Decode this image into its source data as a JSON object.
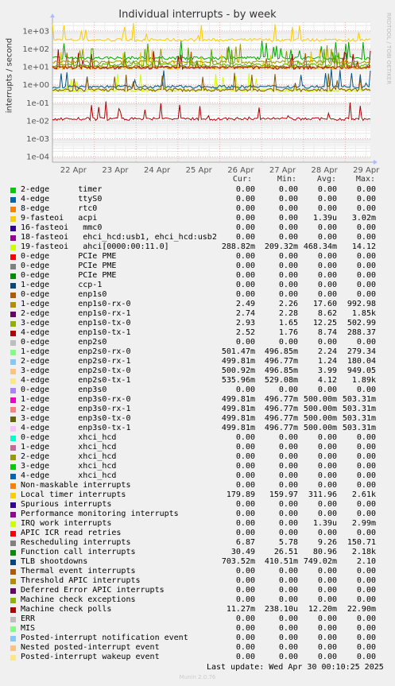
{
  "title": "Individual interrupts - by week",
  "side_text": "RRDTOOL / TOBI OETIKER",
  "footer": "Munin 2.0.76",
  "last_update": "Last update: Wed Apr 30 00:10:25 2025",
  "columns": [
    "Cur:",
    "Min:",
    "Avg:",
    "Max:"
  ],
  "chart_data": {
    "type": "line",
    "title": "Individual interrupts - by week",
    "ylabel": "interrupts / second",
    "yscale": "log",
    "ylim": [
      5e-05,
      3000
    ],
    "yticks": [
      "1e+03",
      "1e+02",
      "1e+01",
      "1e+00",
      "1e-01",
      "1e-02",
      "1e-03",
      "1e-04"
    ],
    "ytick_values": [
      1000,
      100,
      10,
      1,
      0.1,
      0.01,
      0.001,
      0.0001
    ],
    "xlim": [
      0,
      7.6
    ],
    "xticks": [
      "22 Apr",
      "23 Apr",
      "24 Apr",
      "25 Apr",
      "26 Apr",
      "27 Apr",
      "28 Apr",
      "29 Apr"
    ],
    "xtick_values": [
      0.5,
      1.5,
      2.5,
      3.5,
      4.5,
      5.5,
      6.5,
      7.5
    ],
    "grid": true,
    "series": [
      {
        "name": "Local timer interrupts",
        "color": "#ffcc00",
        "base": 300,
        "avg": 311.96
      },
      {
        "name": "Function call interrupts",
        "color": "#00aa00",
        "base": 30,
        "avg": 80.96
      },
      {
        "name": "2-edge enp1s0-rx-1",
        "color": "#f0c400",
        "base": 8.6,
        "avg": 8.62
      },
      {
        "name": "4-edge enp1s0-tx-1",
        "color": "#aa0000",
        "base": 8.7,
        "avg": 8.74
      },
      {
        "name": "Rescheduling interrupts",
        "color": "#aa5500",
        "base": 9.3,
        "avg": 9.26
      },
      {
        "name": "1-edge enp1s0-rx-0",
        "color": "#999900",
        "base": 17.6,
        "avg": 17.6
      },
      {
        "name": "3-edge enp1s0-tx-0",
        "color": "#55aa00",
        "base": 12.2,
        "avg": 12.25
      },
      {
        "name": "19-fasteoi ahci[0000:00:11.0]",
        "color": "#ccff00",
        "base": 0.47,
        "avg": 0.46834
      },
      {
        "name": "TLB shootdowns",
        "color": "#00558a",
        "base": 0.75,
        "avg": 0.74902
      },
      {
        "name": "3-edge enp3s0-tx-0",
        "color": "#8a5500",
        "base": 0.5,
        "avg": 0.5
      },
      {
        "name": "Machine check polls",
        "color": "#aa0000",
        "base": 0.0122,
        "avg": 0.0122
      }
    ]
  },
  "legend": [
    {
      "color": "#00cc00",
      "name": "2-edge      timer",
      "cur": "0.00",
      "min": "0.00",
      "avg": "0.00",
      "max": "0.00"
    },
    {
      "color": "#0066b3",
      "name": "4-edge      ttyS0",
      "cur": "0.00",
      "min": "0.00",
      "avg": "0.00",
      "max": "0.00"
    },
    {
      "color": "#ff8000",
      "name": "8-edge      rtc0",
      "cur": "0.00",
      "min": "0.00",
      "avg": "0.00",
      "max": "0.00"
    },
    {
      "color": "#ffcc00",
      "name": "9-fasteoi   acpi",
      "cur": "0.00",
      "min": "0.00",
      "avg": "1.39u",
      "max": "3.02m"
    },
    {
      "color": "#330099",
      "name": "16-fasteoi   mmc0",
      "cur": "0.00",
      "min": "0.00",
      "avg": "0.00",
      "max": "0.00"
    },
    {
      "color": "#990099",
      "name": "18-fasteoi   ehci_hcd:usb1, ehci_hcd:usb2",
      "cur": "0.00",
      "min": "0.00",
      "avg": "0.00",
      "max": "0.00"
    },
    {
      "color": "#ccff00",
      "name": "19-fasteoi   ahci[0000:00:11.0]",
      "cur": "288.82m",
      "min": "209.32m",
      "avg": "468.34m",
      "max": "14.12"
    },
    {
      "color": "#ff0000",
      "name": "0-edge      PCIe PME",
      "cur": "0.00",
      "min": "0.00",
      "avg": "0.00",
      "max": "0.00"
    },
    {
      "color": "#808080",
      "name": "0-edge      PCIe PME",
      "cur": "0.00",
      "min": "0.00",
      "avg": "0.00",
      "max": "0.00"
    },
    {
      "color": "#008f00",
      "name": "0-edge      PCIe PME",
      "cur": "0.00",
      "min": "0.00",
      "avg": "0.00",
      "max": "0.00"
    },
    {
      "color": "#00487d",
      "name": "1-edge      ccp-1",
      "cur": "0.00",
      "min": "0.00",
      "avg": "0.00",
      "max": "0.00"
    },
    {
      "color": "#b35a00",
      "name": "0-edge      enp1s0",
      "cur": "0.00",
      "min": "0.00",
      "avg": "0.00",
      "max": "0.00"
    },
    {
      "color": "#b38f00",
      "name": "1-edge      enp1s0-rx-0",
      "cur": "2.49",
      "min": "2.26",
      "avg": "17.60",
      "max": "992.98"
    },
    {
      "color": "#6b006b",
      "name": "2-edge      enp1s0-rx-1",
      "cur": "2.74",
      "min": "2.28",
      "avg": "8.62",
      "max": "1.85k"
    },
    {
      "color": "#8fb300",
      "name": "3-edge      enp1s0-tx-0",
      "cur": "2.93",
      "min": "1.65",
      "avg": "12.25",
      "max": "502.99"
    },
    {
      "color": "#b30000",
      "name": "4-edge      enp1s0-tx-1",
      "cur": "2.52",
      "min": "1.76",
      "avg": "8.74",
      "max": "288.37"
    },
    {
      "color": "#bebebe",
      "name": "0-edge      enp2s0",
      "cur": "0.00",
      "min": "0.00",
      "avg": "0.00",
      "max": "0.00"
    },
    {
      "color": "#80ff80",
      "name": "1-edge      enp2s0-rx-0",
      "cur": "501.47m",
      "min": "496.85m",
      "avg": "2.24",
      "max": "279.34"
    },
    {
      "color": "#80c9ff",
      "name": "2-edge      enp2s0-rx-1",
      "cur": "499.81m",
      "min": "496.77m",
      "avg": "1.24",
      "max": "180.04"
    },
    {
      "color": "#ffc080",
      "name": "3-edge      enp2s0-tx-0",
      "cur": "500.92m",
      "min": "496.85m",
      "avg": "3.99",
      "max": "949.05"
    },
    {
      "color": "#ffe680",
      "name": "4-edge      enp2s0-tx-1",
      "cur": "535.96m",
      "min": "529.08m",
      "avg": "4.12",
      "max": "1.89k"
    },
    {
      "color": "#aa80ff",
      "name": "0-edge      enp3s0",
      "cur": "0.00",
      "min": "0.00",
      "avg": "0.00",
      "max": "0.00"
    },
    {
      "color": "#ee00cc",
      "name": "1-edge      enp3s0-rx-0",
      "cur": "499.81m",
      "min": "496.77m",
      "avg": "500.00m",
      "max": "503.31m"
    },
    {
      "color": "#ff8080",
      "name": "2-edge      enp3s0-rx-1",
      "cur": "499.81m",
      "min": "496.77m",
      "avg": "500.00m",
      "max": "503.31m"
    },
    {
      "color": "#666600",
      "name": "3-edge      enp3s0-tx-0",
      "cur": "499.81m",
      "min": "496.77m",
      "avg": "500.00m",
      "max": "503.31m"
    },
    {
      "color": "#ffbfff",
      "name": "4-edge      enp3s0-tx-1",
      "cur": "499.81m",
      "min": "496.77m",
      "avg": "500.00m",
      "max": "503.31m"
    },
    {
      "color": "#00ffcc",
      "name": "0-edge      xhci_hcd",
      "cur": "0.00",
      "min": "0.00",
      "avg": "0.00",
      "max": "0.00"
    },
    {
      "color": "#cc6699",
      "name": "1-edge      xhci_hcd",
      "cur": "0.00",
      "min": "0.00",
      "avg": "0.00",
      "max": "0.00"
    },
    {
      "color": "#999900",
      "name": "2-edge      xhci_hcd",
      "cur": "0.00",
      "min": "0.00",
      "avg": "0.00",
      "max": "0.00"
    },
    {
      "color": "#00cc00",
      "name": "3-edge      xhci_hcd",
      "cur": "0.00",
      "min": "0.00",
      "avg": "0.00",
      "max": "0.00"
    },
    {
      "color": "#0066b3",
      "name": "4-edge      xhci_hcd",
      "cur": "0.00",
      "min": "0.00",
      "avg": "0.00",
      "max": "0.00"
    },
    {
      "color": "#ff8000",
      "name": "Non-maskable interrupts",
      "cur": "0.00",
      "min": "0.00",
      "avg": "0.00",
      "max": "0.00"
    },
    {
      "color": "#ffcc00",
      "name": "Local timer interrupts",
      "cur": "179.89",
      "min": "159.97",
      "avg": "311.96",
      "max": "2.61k"
    },
    {
      "color": "#330099",
      "name": "Spurious interrupts",
      "cur": "0.00",
      "min": "0.00",
      "avg": "0.00",
      "max": "0.00"
    },
    {
      "color": "#990099",
      "name": "Performance monitoring interrupts",
      "cur": "0.00",
      "min": "0.00",
      "avg": "0.00",
      "max": "0.00"
    },
    {
      "color": "#ccff00",
      "name": "IRQ work interrupts",
      "cur": "0.00",
      "min": "0.00",
      "avg": "1.39u",
      "max": "2.99m"
    },
    {
      "color": "#ff0000",
      "name": "APIC ICR read retries",
      "cur": "0.00",
      "min": "0.00",
      "avg": "0.00",
      "max": "0.00"
    },
    {
      "color": "#808080",
      "name": "Rescheduling interrupts",
      "cur": "6.87",
      "min": "5.78",
      "avg": "9.26",
      "max": "150.71"
    },
    {
      "color": "#008f00",
      "name": "Function call interrupts",
      "cur": "30.49",
      "min": "26.51",
      "avg": "80.96",
      "max": "2.18k"
    },
    {
      "color": "#00487d",
      "name": "TLB shootdowns",
      "cur": "703.52m",
      "min": "410.51m",
      "avg": "749.02m",
      "max": "2.10"
    },
    {
      "color": "#b35a00",
      "name": "Thermal event interrupts",
      "cur": "0.00",
      "min": "0.00",
      "avg": "0.00",
      "max": "0.00"
    },
    {
      "color": "#b38f00",
      "name": "Threshold APIC interrupts",
      "cur": "0.00",
      "min": "0.00",
      "avg": "0.00",
      "max": "0.00"
    },
    {
      "color": "#6b006b",
      "name": "Deferred Error APIC interrupts",
      "cur": "0.00",
      "min": "0.00",
      "avg": "0.00",
      "max": "0.00"
    },
    {
      "color": "#8fb300",
      "name": "Machine check exceptions",
      "cur": "0.00",
      "min": "0.00",
      "avg": "0.00",
      "max": "0.00"
    },
    {
      "color": "#b30000",
      "name": "Machine check polls",
      "cur": "11.27m",
      "min": "238.10u",
      "avg": "12.20m",
      "max": "22.90m"
    },
    {
      "color": "#bebebe",
      "name": "ERR",
      "cur": "0.00",
      "min": "0.00",
      "avg": "0.00",
      "max": "0.00"
    },
    {
      "color": "#80ff80",
      "name": "MIS",
      "cur": "0.00",
      "min": "0.00",
      "avg": "0.00",
      "max": "0.00"
    },
    {
      "color": "#80c9ff",
      "name": "Posted-interrupt notification event",
      "cur": "0.00",
      "min": "0.00",
      "avg": "0.00",
      "max": "0.00"
    },
    {
      "color": "#ffc080",
      "name": "Nested posted-interrupt event",
      "cur": "0.00",
      "min": "0.00",
      "avg": "0.00",
      "max": "0.00"
    },
    {
      "color": "#ffe680",
      "name": "Posted-interrupt wakeup event",
      "cur": "0.00",
      "min": "0.00",
      "avg": "0.00",
      "max": "0.00"
    }
  ]
}
